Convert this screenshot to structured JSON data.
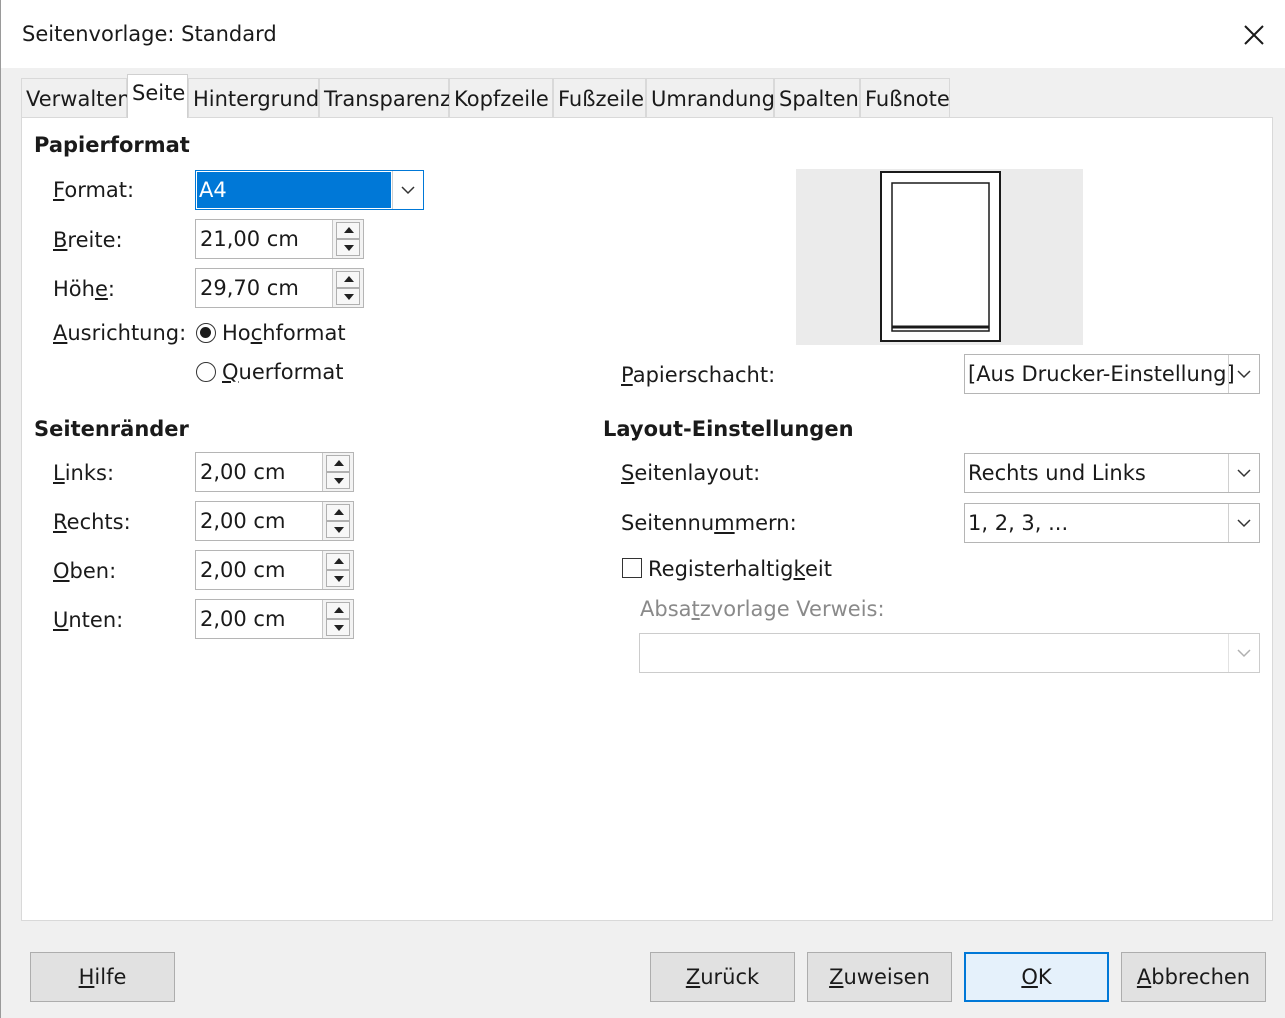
{
  "window": {
    "title": "Seitenvorlage: Standard"
  },
  "tabs": [
    {
      "label": "Verwalten"
    },
    {
      "label": "Seite"
    },
    {
      "label": "Hintergrund"
    },
    {
      "label": "Transparenz"
    },
    {
      "label": "Kopfzeile"
    },
    {
      "label": "Fußzeile"
    },
    {
      "label": "Umrandung"
    },
    {
      "label": "Spalten"
    },
    {
      "label": "Fußnote"
    }
  ],
  "paper": {
    "section_title": "Papierformat",
    "format_label_u": "F",
    "format_label_rest": "ormat:",
    "format_value": "A4",
    "width_label_u": "B",
    "width_label_rest": "reite:",
    "width_value": "21,00 cm",
    "height_label_pre": "Höh",
    "height_label_u": "e",
    "height_label_rest": ":",
    "height_value": "29,70 cm",
    "orientation_label_u": "A",
    "orientation_label_rest": "usrichtung:",
    "portrait_pre": "Ho",
    "portrait_u": "c",
    "portrait_rest": "hformat",
    "landscape_u": "Q",
    "landscape_rest": "uerformat",
    "tray_label_u": "P",
    "tray_label_rest": "apierschacht:",
    "tray_value": "[Aus Drucker-Einstellung]"
  },
  "margins": {
    "section_title": "Seitenränder",
    "left_label_u": "L",
    "left_label_rest": "inks:",
    "left_value": "2,00 cm",
    "right_label_u": "R",
    "right_label_rest": "echts:",
    "right_value": "2,00 cm",
    "top_label_u": "O",
    "top_label_rest": "ben:",
    "top_value": "2,00 cm",
    "bottom_label_u": "U",
    "bottom_label_rest": "nten:",
    "bottom_value": "2,00 cm"
  },
  "layout": {
    "section_title": "Layout-Einstellungen",
    "page_layout_label_u": "S",
    "page_layout_label_rest": "eitenlayout:",
    "page_layout_value": "Rechts und Links",
    "numbering_label_pre": "Seitennu",
    "numbering_label_u": "m",
    "numbering_label_rest": "mern:",
    "numbering_value": "1, 2, 3, ...",
    "register_pre": "Registerhaltig",
    "register_u": "k",
    "register_rest": "eit",
    "ref_style_pre": "Absa",
    "ref_style_u": "t",
    "ref_style_rest": "zvorlage Verweis:",
    "ref_style_value": ""
  },
  "buttons": {
    "help_u": "H",
    "help_rest": "ilfe",
    "reset_u": "Z",
    "reset_rest": "urück",
    "apply_u": "Z",
    "apply_rest": "uweisen",
    "ok_u": "O",
    "ok_rest": "K",
    "cancel_u": "A",
    "cancel_rest": "bbrechen"
  },
  "colors": {
    "accent": "#0078d7",
    "selection": "#0078d7"
  },
  "icons": {
    "close": "close-icon",
    "dropdown": "chevron-down-icon"
  }
}
